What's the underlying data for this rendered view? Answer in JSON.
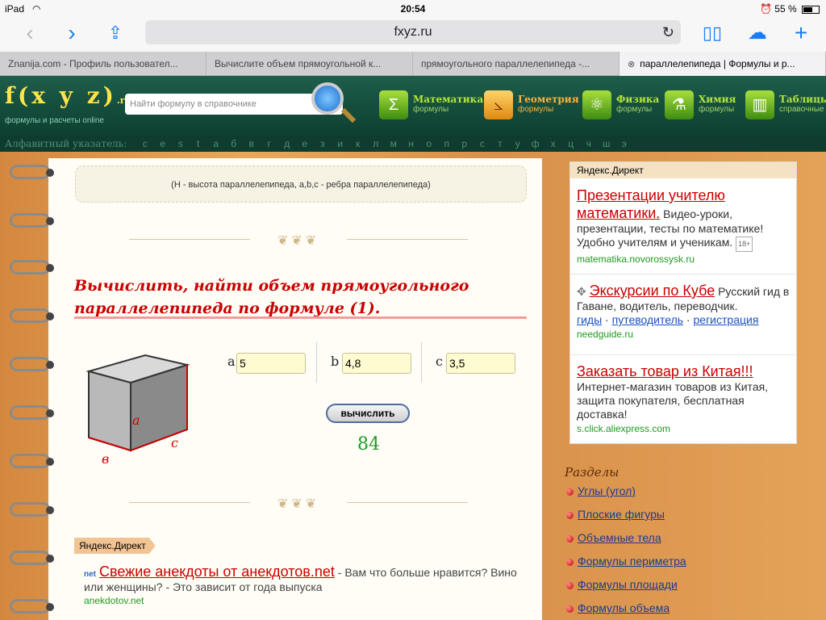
{
  "status": {
    "device": "iPad",
    "time": "20:54",
    "battery": "55 %"
  },
  "browser": {
    "url": "fxyz.ru",
    "tabs": [
      {
        "label": "Znanija.com - Профиль пользовател..."
      },
      {
        "label": "Вычислите объем прямоугольной к..."
      },
      {
        "label": "прямоугольного параллелепипеда -..."
      },
      {
        "label": "параллелепипеда | Формулы и р..."
      }
    ]
  },
  "site": {
    "logo_text": "f(x y z)",
    "logo_ru": ".ru",
    "logo_sub": "формулы и расчеты online",
    "search_placeholder": "Найти формулу в справочнике",
    "nav": [
      {
        "title": "Математика",
        "sub": "формулы",
        "icon": "sigma-icon",
        "glyph": "Σ"
      },
      {
        "title": "Геометрия",
        "sub": "формулы",
        "icon": "compass-icon",
        "glyph": "⦣"
      },
      {
        "title": "Физика",
        "sub": "формулы",
        "icon": "atom-icon",
        "glyph": "⚛"
      },
      {
        "title": "Химия",
        "sub": "формулы",
        "icon": "flask-icon",
        "glyph": "⚗"
      },
      {
        "title": "Таблицы",
        "sub": "справочные",
        "icon": "books-icon",
        "glyph": "▥"
      }
    ],
    "alphabet_label": "Алфавитный указатель:",
    "alphabet": [
      "c",
      "e",
      "s",
      "t",
      "а",
      "б",
      "в",
      "г",
      "д",
      "е",
      "з",
      "и",
      "к",
      "л",
      "м",
      "н",
      "о",
      "п",
      "р",
      "с",
      "т",
      "у",
      "ф",
      "х",
      "ц",
      "ч",
      "ш",
      "э"
    ]
  },
  "main": {
    "formula_note": "(H - высота параллелепипеда, a,b,c - ребра параллелепипеда)",
    "calc_title": "Вычислить, найти объем прямоугольного параллелепипеда по формуле (1).",
    "cube_labels": {
      "a": "a",
      "b": "в",
      "c": "c"
    },
    "fields": [
      {
        "label": "a",
        "value": "5"
      },
      {
        "label": "b",
        "value": "4,8"
      },
      {
        "label": "c",
        "value": "3,5"
      }
    ],
    "calc_button": "вычислить",
    "result": "84",
    "direct_tag": "Яндекс.Директ",
    "bottom_ad": {
      "logo": "net",
      "title": "Свежие анекдоты от анекдотов.net",
      "text": " - Вам что больше нравится? Вино или женщины? - Это зависит от года выпуска",
      "domain": "anekdotov.net"
    }
  },
  "right": {
    "ad_header": "Яндекс.Директ",
    "ads": [
      {
        "title": "Презентации учителю математики.",
        "text": " Видео-уроки, презентации, тесты по математике! Удобно учителям и ученикам.",
        "badge": "18+",
        "domain": "matematika.novorossysk.ru"
      },
      {
        "title": "Экскурсии по Кубе",
        "text": " Русский гид в Гаване, водитель, переводчик.",
        "links": [
          "гиды",
          "путеводитель",
          "регистрация"
        ],
        "domain": "needguide.ru"
      },
      {
        "title": "Заказать товар из Китая!!!",
        "text": "Интернет-магазин товаров из Китая, защита покупателя, бесплатная доставка!",
        "domain": "s.click.aliexpress.com"
      }
    ],
    "sections_title": "Разделы",
    "sections": [
      "Углы (угол)",
      "Плоские фигуры",
      "Объемные тела",
      "Формулы периметра",
      "Формулы площади",
      "Формулы объема"
    ]
  }
}
